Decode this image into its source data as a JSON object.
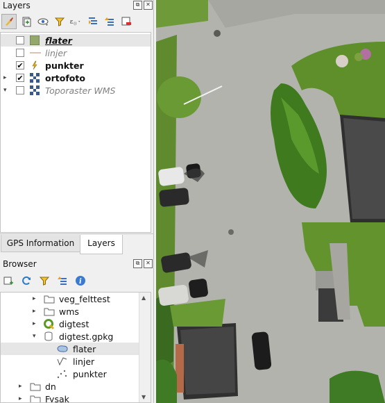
{
  "layers_panel": {
    "title": "Layers",
    "float_glyph": "⧉",
    "close_glyph": "✕",
    "toolbar_icons": [
      "paintbrush-icon",
      "add-group-icon",
      "eye-icon",
      "filter-icon",
      "expression-filter-icon",
      "expand-all-icon",
      "collapse-all-icon",
      "remove-layer-icon"
    ],
    "items": [
      {
        "label": "flater",
        "checked": false,
        "style": "bold-italic-underline",
        "icon": "polygon-icon",
        "expand": ""
      },
      {
        "label": "linjer",
        "checked": false,
        "style": "italic-gray",
        "icon": "line-icon",
        "expand": ""
      },
      {
        "label": "punkter",
        "checked": true,
        "style": "bold",
        "icon": "point-icon",
        "expand": ""
      },
      {
        "label": "ortofoto",
        "checked": true,
        "style": "bold",
        "icon": "raster-icon",
        "expand": "▸"
      },
      {
        "label": "Toporaster WMS",
        "checked": false,
        "style": "italic-gray",
        "icon": "raster-icon",
        "expand": "▾"
      }
    ],
    "check_glyph": "✔"
  },
  "tabs": {
    "gps": "GPS Information",
    "layers": "Layers"
  },
  "browser_panel": {
    "title": "Browser",
    "float_glyph": "⧉",
    "close_glyph": "✕",
    "items": [
      {
        "label": "veg_felttest",
        "icon": "folder-icon",
        "arrow": "▸"
      },
      {
        "label": "wms",
        "icon": "folder-icon",
        "arrow": "▸"
      },
      {
        "label": "digtest",
        "icon": "qgis-project-icon",
        "arrow": "▸"
      },
      {
        "label": "digtest.gpkg",
        "icon": "geopackage-icon",
        "arrow": "▾"
      },
      {
        "label": "flater",
        "icon": "polygon-layer-icon",
        "arrow": ""
      },
      {
        "label": "linjer",
        "icon": "line-layer-icon",
        "arrow": ""
      },
      {
        "label": "punkter",
        "icon": "point-layer-icon",
        "arrow": ""
      },
      {
        "label": "dn",
        "icon": "folder-icon",
        "arrow": "▸"
      },
      {
        "label": "Fysak",
        "icon": "folder-icon",
        "arrow": "▸"
      }
    ]
  },
  "colors": {
    "panel_bg": "#f0f0f0",
    "tree_bg": "#ffffff",
    "selection": "#e6e6e6",
    "polygon_fill": "#93a86a",
    "map_asphalt": "#b3b3ad",
    "map_grass": "#5f8f2a",
    "map_roof": "#3c3c3c"
  }
}
